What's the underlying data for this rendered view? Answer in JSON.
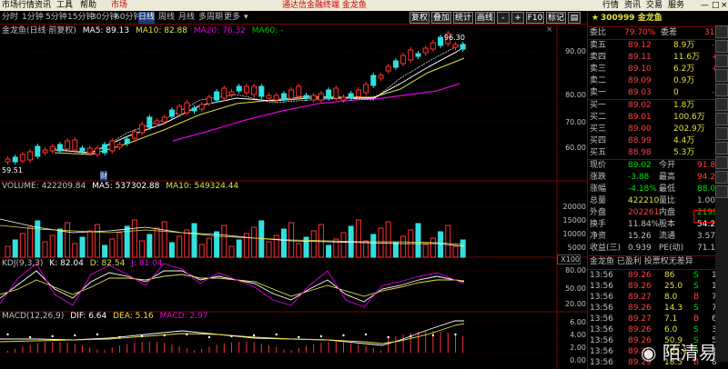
{
  "menubar": {
    "items": [
      "市场行情",
      "资讯",
      "工具",
      "帮助"
    ],
    "market_label": "市场",
    "window_title": "通达信金融终端 金龙鱼",
    "right_items": [
      "行情",
      "资讯",
      "交易",
      "服务"
    ]
  },
  "toolbar": {
    "periods": [
      "分时",
      "1分钟",
      "5分钟",
      "15分钟",
      "30分钟",
      "60分钟",
      "日线",
      "周线",
      "月线",
      "多周期",
      "更多"
    ],
    "active_period": "日线",
    "buttons": [
      "复权",
      "叠加",
      "统计",
      "画线",
      "F10",
      "标记"
    ]
  },
  "kline_header": {
    "name": "金龙鱼(日线 前复权)",
    "ma5": "MA5: 89.13",
    "ma10": "MA10: 82.88",
    "ma20": "MA20: 76.32",
    "ma60": "MA60: -"
  },
  "kline_chart": {
    "high_label": "96.30",
    "low_label": "59.51",
    "marker": "财",
    "y_ticks": [
      "90.00",
      "80.00",
      "70.00",
      "60.00"
    ]
  },
  "volume_header": {
    "name": "VOLUME: 422209.84",
    "ma5": "MA5: 537302.88",
    "ma10": "MA10: 549324.44",
    "y_ticks": [
      "20000",
      "15000",
      "10000",
      "5000"
    ],
    "unit": "X100"
  },
  "kdj_header": {
    "name": "KDJ(9,3,3)",
    "k": "K: 82.04",
    "d": "D: 82.54",
    "j": "J: 81.04",
    "y_ticks": [
      "80.00",
      "50.00",
      "20.00"
    ]
  },
  "macd_header": {
    "name": "MACD(12,26,9)",
    "dif": "DIF: 6.64",
    "dea": "DEA: 5.16",
    "macd": "MACD: 2.97",
    "y_ticks": [
      "6.00",
      "4.00",
      "2.00",
      "0.00"
    ]
  },
  "quote": {
    "code_name": "300999 金龙鱼",
    "weibi_label": "委比",
    "weibi_value": "79.70%",
    "weicha_label": "委差",
    "weicha_value": "314",
    "asks": [
      {
        "label": "卖五",
        "price": "89.12",
        "vol": "8.9万",
        "chg": "-3"
      },
      {
        "label": "卖四",
        "price": "89.11",
        "vol": "11.6万",
        "chg": "+3"
      },
      {
        "label": "卖三",
        "price": "89.10",
        "vol": "6.2万",
        "chg": "+3"
      },
      {
        "label": "卖二",
        "price": "89.09",
        "vol": "0.9万",
        "chg": ""
      },
      {
        "label": "卖一",
        "price": "89.03",
        "vol": "0",
        "chg": "-8"
      }
    ],
    "bids": [
      {
        "label": "买一",
        "price": "89.02",
        "vol": "1.8万",
        "chg": ""
      },
      {
        "label": "买二",
        "price": "89.01",
        "vol": "100.6万",
        "chg": ""
      },
      {
        "label": "买三",
        "price": "89.00",
        "vol": "202.9万",
        "chg": ""
      },
      {
        "label": "买四",
        "price": "88.99",
        "vol": "4.4万",
        "chg": ""
      },
      {
        "label": "买五",
        "price": "88.98",
        "vol": "5.3万",
        "chg": ""
      }
    ],
    "stats": [
      {
        "l1": "现价",
        "v1": "89.02",
        "l2": "今开",
        "v2": "91.81"
      },
      {
        "l1": "涨跌",
        "v1": "-3.88",
        "l2": "最高",
        "v2": "94.20"
      },
      {
        "l1": "涨幅",
        "v1": "-4.18%",
        "l2": "最低",
        "v2": "88.00"
      },
      {
        "l1": "总量",
        "v1": "422210",
        "l2": "量比",
        "v2": "1.00"
      },
      {
        "l1": "外盘",
        "v1": "202261",
        "l2": "内盘",
        "v2": "219949"
      },
      {
        "l1": "换手",
        "v1": "11.84%",
        "l2": "股本",
        "v2": "54.2亿"
      },
      {
        "l1": "净资",
        "v1": "15.26",
        "l2": "流通",
        "v2": "3.57亿"
      },
      {
        "l1": "收益(三)",
        "v1": "0.939",
        "l2": "PE(动)",
        "v2": "71.1"
      }
    ],
    "notice": "金龙鱼 已盈利 投票权无差异",
    "ticks": [
      {
        "time": "13:56",
        "price": "89.26",
        "vol": "86",
        "bs": "S",
        "n": "18"
      },
      {
        "time": "13:56",
        "price": "89.26",
        "vol": "25.0",
        "bs": "S",
        "n": "11"
      },
      {
        "time": "13:56",
        "price": "89.27",
        "vol": "8.0",
        "bs": "B",
        "n": "7"
      },
      {
        "time": "13:56",
        "price": "89.26",
        "vol": "14.3",
        "bs": "S",
        "n": "7"
      },
      {
        "time": "13:56",
        "price": "89.27",
        "vol": "7.1",
        "bs": "B",
        "n": "6"
      },
      {
        "time": "13:56",
        "price": "89.26",
        "vol": "6.0",
        "bs": "S",
        "n": "3"
      },
      {
        "time": "13:56",
        "price": "89.26",
        "vol": "50.9",
        "bs": "S",
        "n": "5"
      },
      {
        "time": "13:56",
        "price": "89.25",
        "vol": "165.1",
        "bs": "S",
        "n": "4"
      },
      {
        "time": "13:56",
        "price": "89.29",
        "vol": "18.5",
        "bs": "B",
        "n": "8"
      }
    ]
  },
  "watermark": "陌清易"
}
